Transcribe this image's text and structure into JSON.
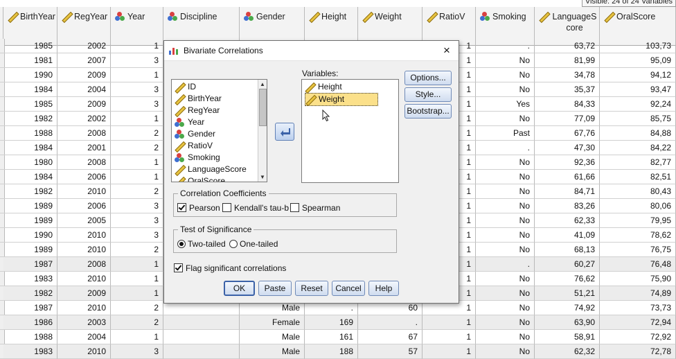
{
  "visible_info": "Visible: 24 of 24 Variables",
  "columns": [
    {
      "key": "birthyear",
      "label": "BirthYear",
      "icon": "ruler-icon"
    },
    {
      "key": "regyear",
      "label": "RegYear",
      "icon": "ruler-icon"
    },
    {
      "key": "year",
      "label": "Year",
      "icon": "nominal-icon"
    },
    {
      "key": "discipline",
      "label": "Discipline",
      "icon": "nominal-icon"
    },
    {
      "key": "gender",
      "label": "Gender",
      "icon": "nominal-icon"
    },
    {
      "key": "height",
      "label": "Height",
      "icon": "ruler-icon"
    },
    {
      "key": "weight",
      "label": "Weight",
      "icon": "ruler-icon"
    },
    {
      "key": "ratiov",
      "label": "RatioV",
      "icon": "ruler-icon"
    },
    {
      "key": "smoking",
      "label": "Smoking",
      "icon": "nominal-icon"
    },
    {
      "key": "languagescore",
      "label": "LanguageScore",
      "icon": "ruler-icon"
    },
    {
      "key": "oralscore",
      "label": "OralScore",
      "icon": "ruler-icon"
    }
  ],
  "rows": [
    [
      "1985",
      "2002",
      "1",
      "",
      "",
      "",
      "",
      "1",
      ".",
      "63,72",
      "103,73"
    ],
    [
      "1981",
      "2007",
      "3",
      "",
      "",
      "",
      "",
      "1",
      "No",
      "81,99",
      "95,09"
    ],
    [
      "1990",
      "2009",
      "1",
      "",
      "",
      "",
      "",
      "1",
      "No",
      "34,78",
      "94,12"
    ],
    [
      "1984",
      "2004",
      "3",
      "",
      "",
      "",
      "",
      "1",
      "No",
      "35,37",
      "93,47"
    ],
    [
      "1985",
      "2009",
      "3",
      "",
      "",
      "",
      "",
      "1",
      "Yes",
      "84,33",
      "92,24"
    ],
    [
      "1982",
      "2002",
      "1",
      "",
      "",
      "",
      "",
      "1",
      "No",
      "77,09",
      "85,75"
    ],
    [
      "1988",
      "2008",
      "2",
      "",
      "",
      "",
      "",
      "1",
      "Past",
      "67,76",
      "84,88"
    ],
    [
      "1984",
      "2001",
      "2",
      "",
      "",
      "",
      "",
      "1",
      ".",
      "47,30",
      "84,22"
    ],
    [
      "1980",
      "2008",
      "1",
      "",
      "",
      "",
      "",
      "1",
      "No",
      "92,36",
      "82,77"
    ],
    [
      "1984",
      "2006",
      "1",
      "",
      "",
      "",
      "",
      "1",
      "No",
      "61,66",
      "82,51"
    ],
    [
      "1982",
      "2010",
      "2",
      "",
      "",
      "",
      "",
      "1",
      "No",
      "84,71",
      "80,43"
    ],
    [
      "1989",
      "2006",
      "3",
      "",
      "",
      "",
      "",
      "1",
      "No",
      "83,26",
      "80,06"
    ],
    [
      "1989",
      "2005",
      "3",
      "",
      "",
      "",
      "",
      "1",
      "No",
      "62,33",
      "79,95"
    ],
    [
      "1990",
      "2010",
      "3",
      "",
      "",
      "",
      "",
      "1",
      "No",
      "41,09",
      "78,62"
    ],
    [
      "1989",
      "2010",
      "2",
      "",
      "",
      "",
      "",
      "1",
      "No",
      "68,13",
      "76,75"
    ],
    [
      "1987",
      "2008",
      "1",
      "",
      "",
      "",
      "",
      "1",
      ".",
      "60,27",
      "76,48"
    ],
    [
      "1983",
      "2010",
      "1",
      "",
      "",
      "",
      "",
      "1",
      "No",
      "76,62",
      "75,90"
    ],
    [
      "1982",
      "2009",
      "1",
      "",
      "",
      "",
      "",
      "1",
      "No",
      "51,21",
      "74,89"
    ],
    [
      "1987",
      "2010",
      "2",
      "",
      "Male",
      ".",
      "60",
      "1",
      "No",
      "74,92",
      "73,73"
    ],
    [
      "1986",
      "2003",
      "2",
      "",
      "Female",
      "169",
      ".",
      "1",
      "No",
      "63,90",
      "72,94"
    ],
    [
      "1988",
      "2004",
      "1",
      "",
      "Male",
      "161",
      "67",
      "1",
      "No",
      "58,91",
      "72,92"
    ],
    [
      "1983",
      "2010",
      "3",
      "",
      "Male",
      "188",
      "57",
      "1",
      "No",
      "62,32",
      "72,78"
    ]
  ],
  "dialog": {
    "title": "Bivariate Correlations",
    "close": "×",
    "source_list": [
      {
        "label": "ID",
        "icon": "ruler-icon"
      },
      {
        "label": "BirthYear",
        "icon": "ruler-icon"
      },
      {
        "label": "RegYear",
        "icon": "ruler-icon"
      },
      {
        "label": "Year",
        "icon": "nominal-icon"
      },
      {
        "label": "Gender",
        "icon": "nominal-icon"
      },
      {
        "label": "RatioV",
        "icon": "ruler-icon"
      },
      {
        "label": "Smoking",
        "icon": "nominal-icon"
      },
      {
        "label": "LanguageScore",
        "icon": "ruler-icon"
      },
      {
        "label": "OralScore",
        "icon": "ruler-icon"
      }
    ],
    "variables_label": "Variables:",
    "variables": [
      {
        "label": "Height",
        "icon": "ruler-icon",
        "selected": false
      },
      {
        "label": "Weight",
        "icon": "ruler-icon",
        "selected": true
      }
    ],
    "buttons_side": [
      "Options...",
      "Style...",
      "Bootstrap..."
    ],
    "coef_group": "Correlation Coefficients",
    "pearson": "Pearson",
    "kendall": "Kendall's tau-b",
    "spearman": "Spearman",
    "sig_group": "Test of Significance",
    "two_tailed": "Two-tailed",
    "one_tailed": "One-tailed",
    "flag": "Flag significant correlations",
    "buttons_bottom": [
      "OK",
      "Paste",
      "Reset",
      "Cancel",
      "Help"
    ]
  },
  "colors": {
    "selected_highlight": "#fbe08a",
    "button_border": "#6f8ab7",
    "accent": "#3f6fd0"
  }
}
